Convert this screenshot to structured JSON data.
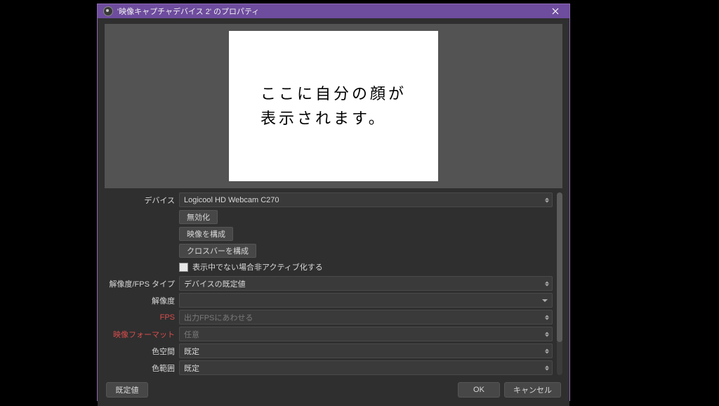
{
  "dialog": {
    "title": "'映像キャプチャデバイス 2' のプロパティ"
  },
  "preview": {
    "text": "ここに自分の顔が\n表示されます。"
  },
  "fields": {
    "device": {
      "label": "デバイス",
      "value": "Logicool HD Webcam C270"
    },
    "disable_btn": "無効化",
    "configure_video_btn": "映像を構成",
    "configure_crossbar_btn": "クロスバーを構成",
    "deactivate_checkbox": "表示中でない場合非アクティブ化する",
    "res_fps_type": {
      "label": "解像度/FPS タイプ",
      "value": "デバイスの既定値"
    },
    "resolution": {
      "label": "解像度",
      "value": ""
    },
    "fps": {
      "label": "FPS",
      "value": "出力FPSにあわせる"
    },
    "video_format": {
      "label": "映像フォーマット",
      "value": "任意"
    },
    "colorspace": {
      "label": "色空間",
      "value": "既定"
    },
    "color_range": {
      "label": "色範囲",
      "value": "既定"
    }
  },
  "footer": {
    "defaults": "既定値",
    "ok": "OK",
    "cancel": "キャンセル"
  }
}
